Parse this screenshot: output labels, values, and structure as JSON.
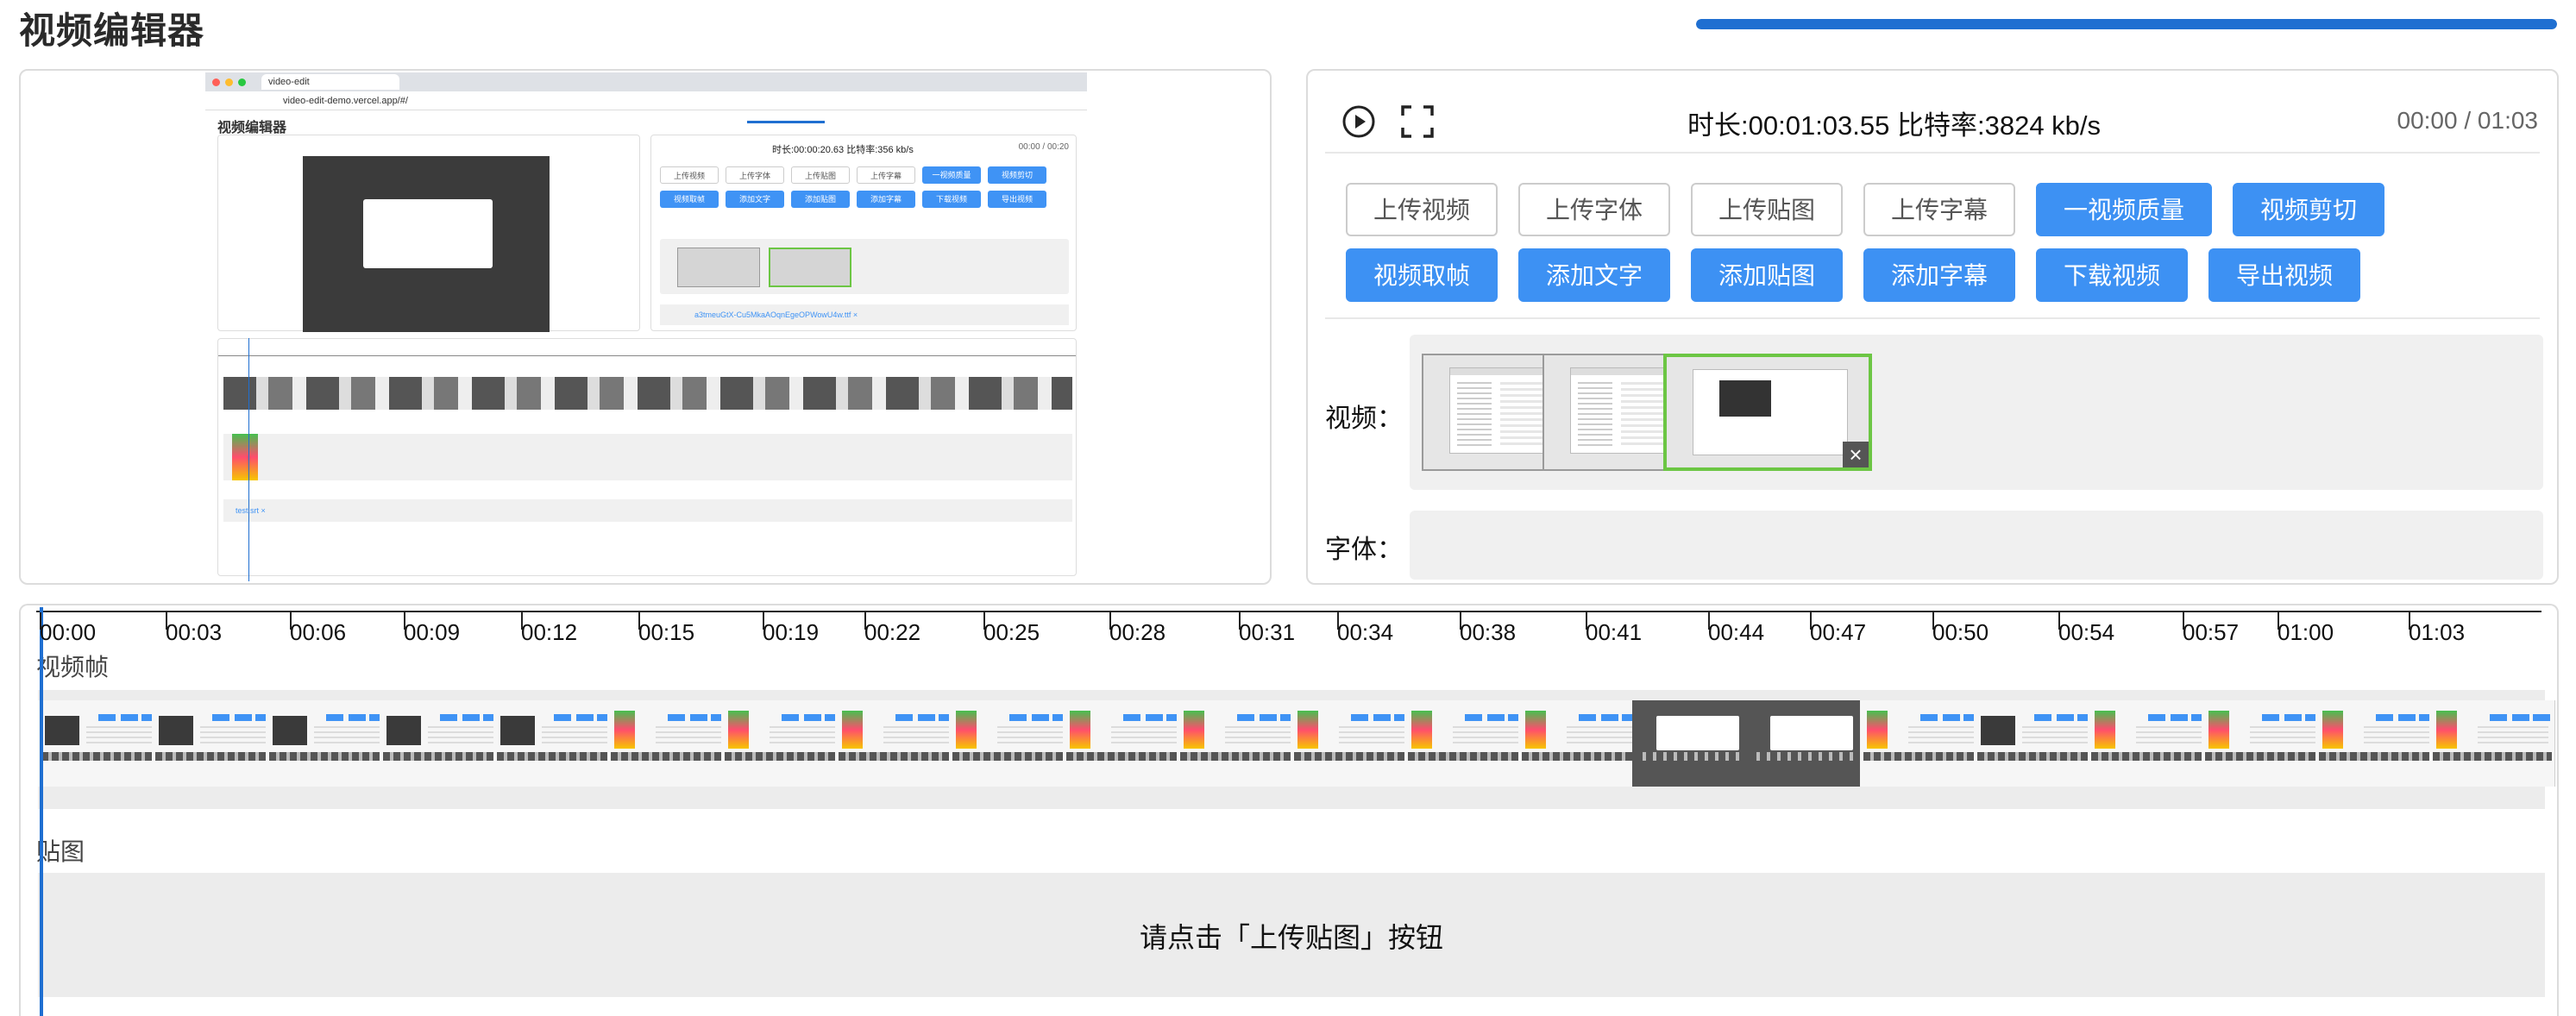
{
  "app": {
    "title": "视频编辑器",
    "progress_fraction": 1.0
  },
  "preview": {
    "browser_tab": "video-edit",
    "browser_url": "video-edit-demo.vercel.app/#/",
    "inner_title": "视频编辑器",
    "inner_stats": "时长:00:00:20.63 比特率:356 kb/s",
    "inner_time": "00:00 / 00:20",
    "inner_buttons_row1": [
      "上传视频",
      "上传字体",
      "上传贴图",
      "上传字幕",
      "一视频质量",
      "视频剪切"
    ],
    "inner_buttons_row2": [
      "视频取帧",
      "添加文字",
      "添加贴图",
      "添加字幕",
      "下载视频",
      "导出视频"
    ],
    "inner_font": "a3tmeuGtX-Cu5MkaAOqnEgeOPWowU4w.ttf ×",
    "inner_sub": "test.srt ×"
  },
  "controls": {
    "stats": "时长:00:01:03.55 比特率:3824 kb/s",
    "time_current": "00:00",
    "time_separator": "/",
    "time_total": "01:03",
    "buttons_row1": [
      {
        "label": "上传视频",
        "style": "outline"
      },
      {
        "label": "上传字体",
        "style": "outline"
      },
      {
        "label": "上传贴图",
        "style": "outline"
      },
      {
        "label": "上传字幕",
        "style": "outline"
      },
      {
        "label": "一视频质量",
        "style": "primary"
      },
      {
        "label": "视频剪切",
        "style": "primary"
      }
    ],
    "buttons_row2": [
      {
        "label": "视频取帧",
        "style": "primary"
      },
      {
        "label": "添加文字",
        "style": "primary"
      },
      {
        "label": "添加贴图",
        "style": "primary"
      },
      {
        "label": "添加字幕",
        "style": "primary"
      },
      {
        "label": "下载视频",
        "style": "primary"
      },
      {
        "label": "导出视频",
        "style": "primary"
      }
    ],
    "video_label": "视频：",
    "font_label": "字体：",
    "video_thumbs": [
      {
        "selected": false
      },
      {
        "selected": false
      },
      {
        "selected": true
      }
    ],
    "close_glyph": "×"
  },
  "timeline": {
    "ticks": [
      "00:00",
      "00:03",
      "00:06",
      "00:09",
      "00:12",
      "00:15",
      "00:19",
      "00:22",
      "00:25",
      "00:28",
      "00:31",
      "00:34",
      "00:38",
      "00:41",
      "00:44",
      "00:47",
      "00:50",
      "00:54",
      "00:57",
      "01:00",
      "01:03"
    ],
    "frames_label": "视频帧",
    "sticker_label": "贴图",
    "sticker_hint": "请点击「上传贴图」按钮",
    "frame_kinds": [
      "plain",
      "plain",
      "plain",
      "plain",
      "plain",
      "green",
      "green",
      "green",
      "green",
      "green",
      "green",
      "green",
      "green",
      "green",
      "dark",
      "dark",
      "green",
      "plain",
      "green",
      "green",
      "green",
      "green"
    ]
  },
  "colors": {
    "primary": "#3d91f3",
    "accent_progress": "#1f6fd1",
    "selected_border": "#6cc644"
  },
  "icons": {
    "play": "play-circle-icon",
    "fullscreen": "fullscreen-icon",
    "close": "close-icon"
  }
}
